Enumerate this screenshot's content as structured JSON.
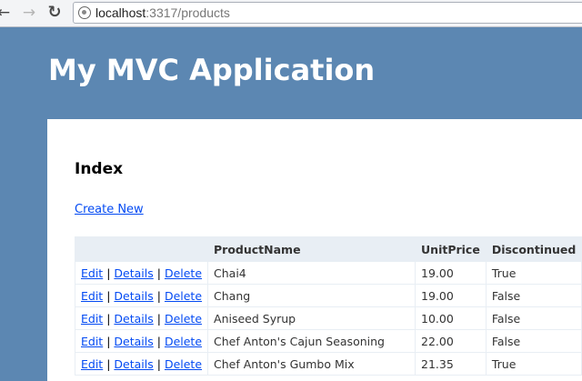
{
  "browser": {
    "url_host": "localhost",
    "url_path": ":3317/products",
    "back_icon": "arrow-left-icon",
    "forward_icon": "arrow-right-icon",
    "reload_icon": "reload-icon"
  },
  "header": {
    "title": "My MVC Application"
  },
  "main": {
    "heading": "Index",
    "create_link": "Create New",
    "columns": [
      "",
      "ProductName",
      "UnitPrice",
      "Discontinued"
    ],
    "action_labels": {
      "edit": "Edit",
      "details": "Details",
      "delete": "Delete",
      "separator": "|"
    },
    "rows": [
      {
        "name": "Chai4",
        "price": "19.00",
        "discontinued": "True"
      },
      {
        "name": "Chang",
        "price": "19.00",
        "discontinued": "False"
      },
      {
        "name": "Aniseed Syrup",
        "price": "10.00",
        "discontinued": "False"
      },
      {
        "name": "Chef Anton's Cajun Seasoning",
        "price": "22.00",
        "discontinued": "False"
      },
      {
        "name": "Chef Anton's Gumbo Mix",
        "price": "21.35",
        "discontinued": "True"
      }
    ]
  },
  "colors": {
    "page_bg": "#5c87b2",
    "link": "#034af3",
    "header_row": "#e8eef4"
  }
}
